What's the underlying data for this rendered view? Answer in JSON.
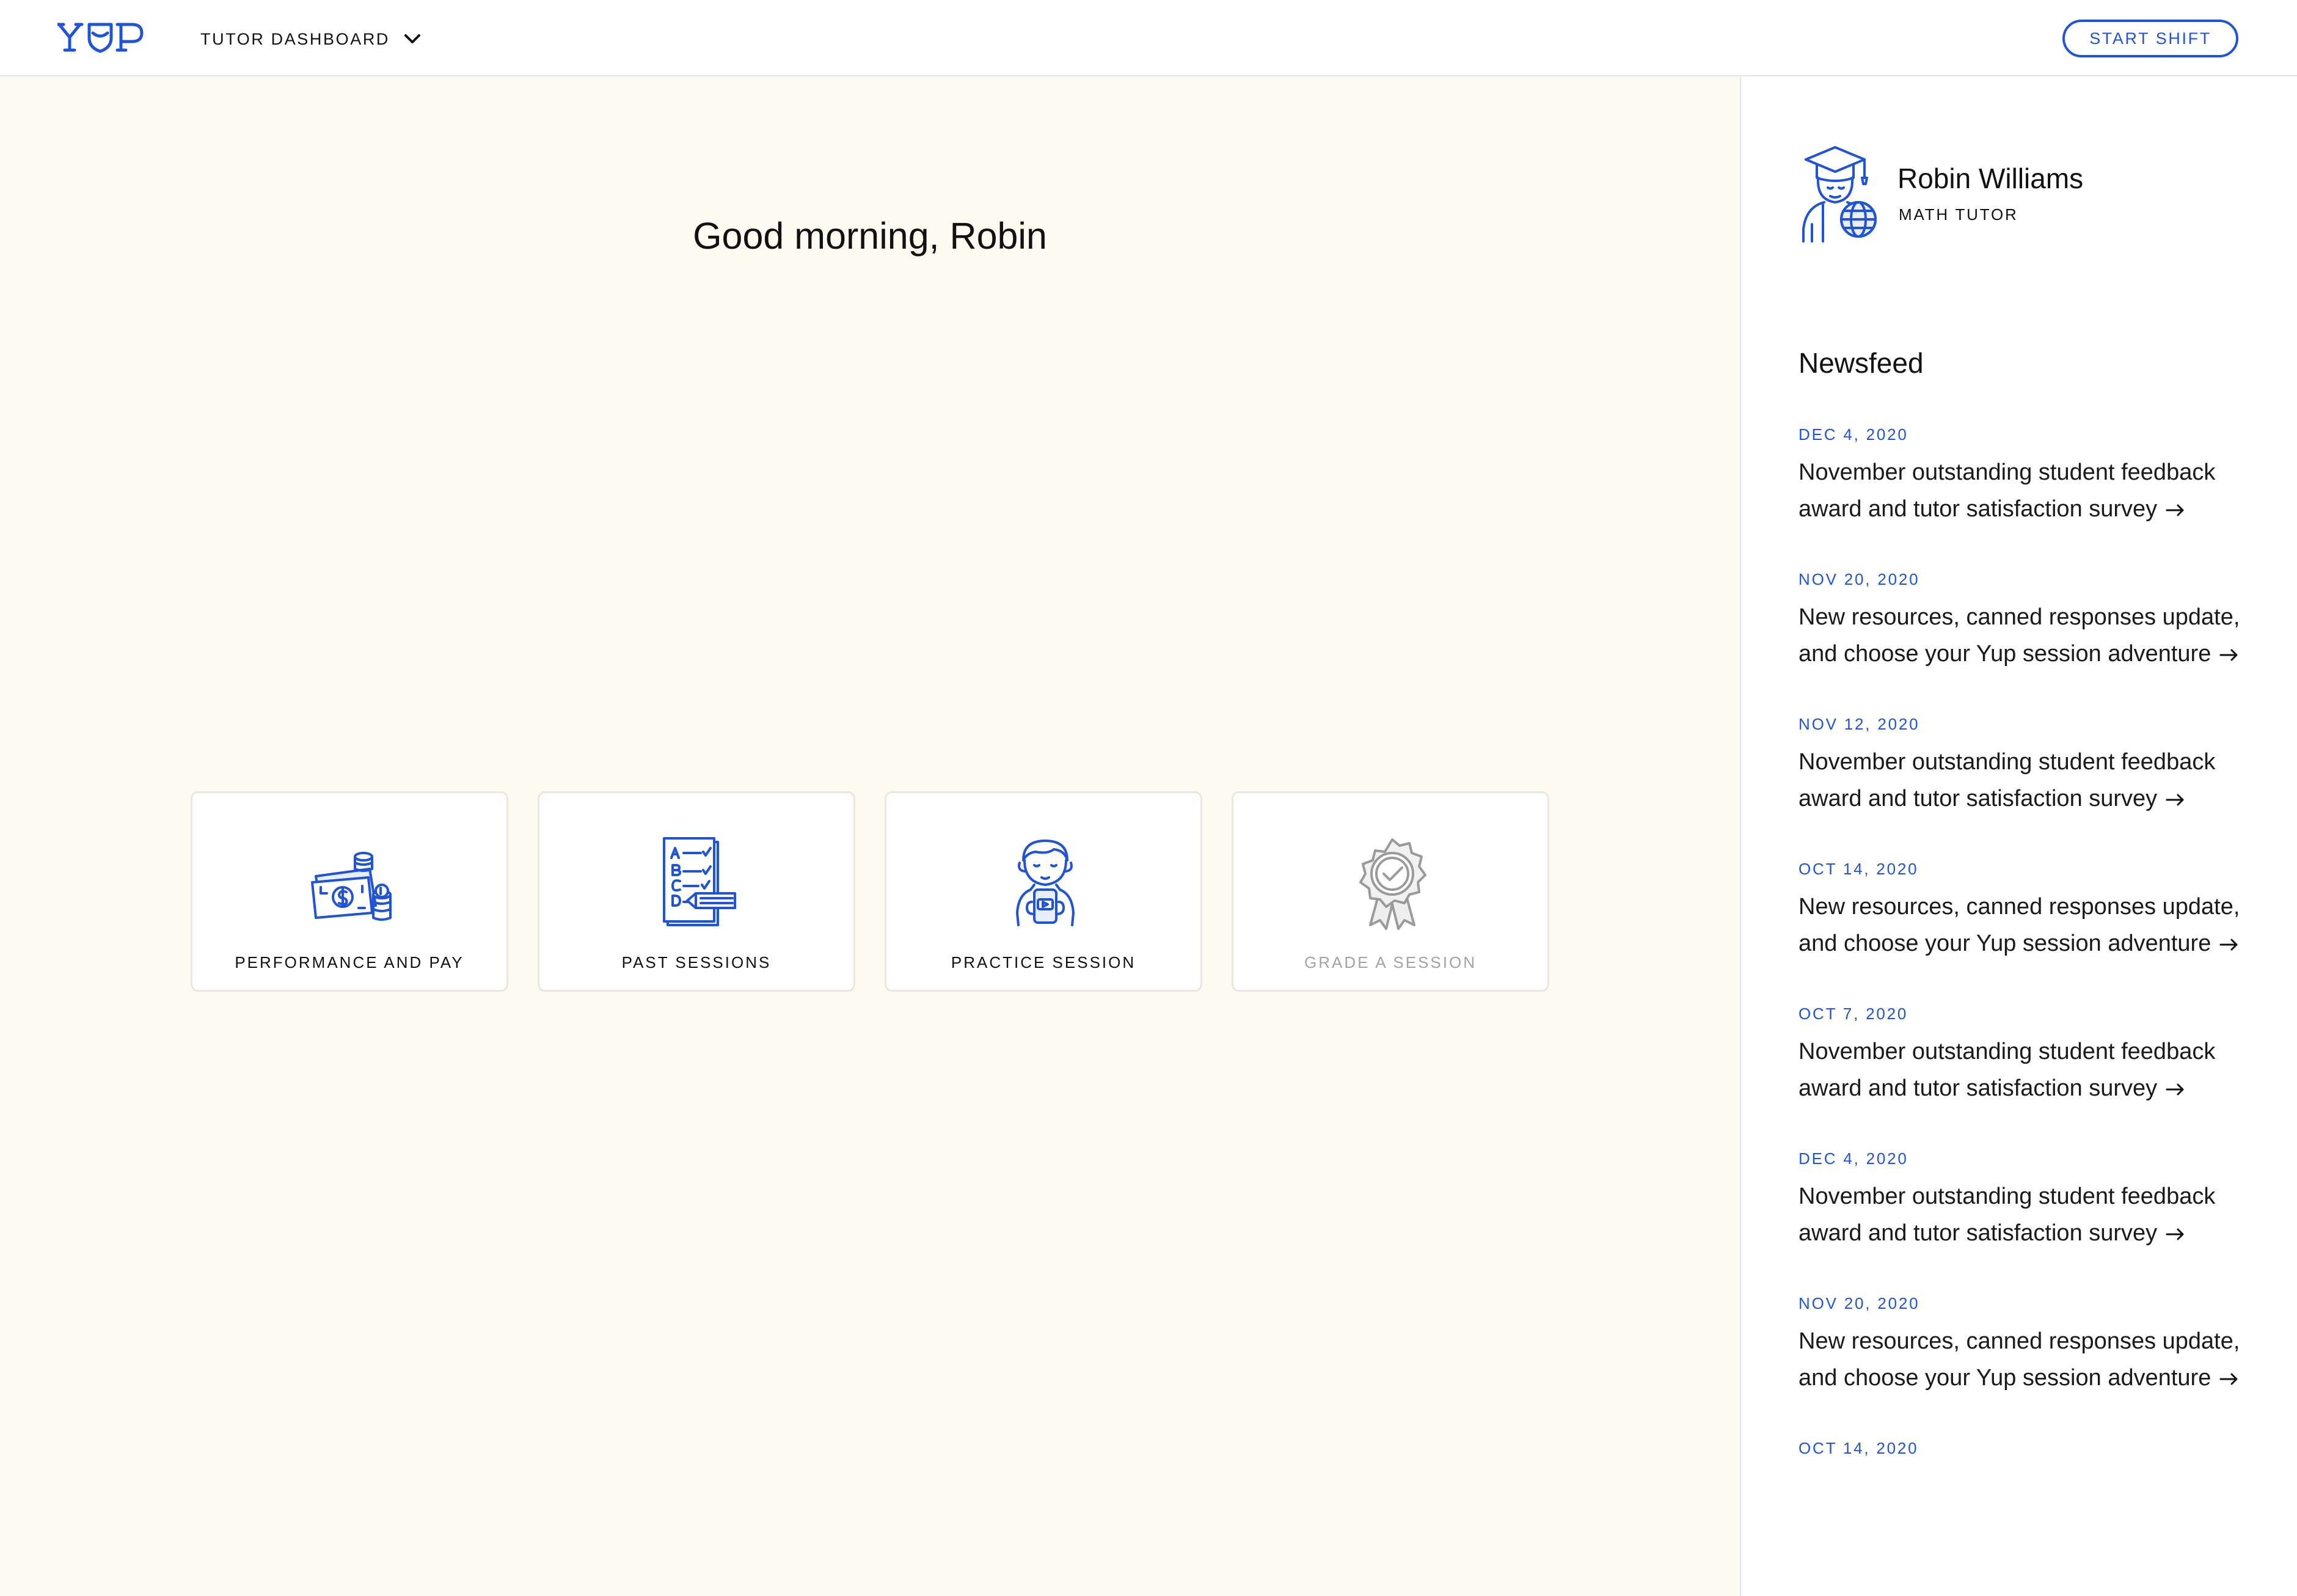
{
  "header": {
    "logo_text": "YUP",
    "nav_label": "TUTOR DASHBOARD",
    "start_shift_label": "START SHIFT"
  },
  "main": {
    "greeting": "Good morning, Robin",
    "cards": [
      {
        "label": "PERFORMANCE AND PAY",
        "icon": "money-coins-icon",
        "enabled": true
      },
      {
        "label": "PAST SESSIONS",
        "icon": "checklist-pencil-icon",
        "enabled": true
      },
      {
        "label": "PRACTICE SESSION",
        "icon": "student-phone-icon",
        "enabled": true
      },
      {
        "label": "GRADE A SESSION",
        "icon": "award-badge-icon",
        "enabled": false
      }
    ]
  },
  "profile": {
    "name": "Robin Williams",
    "role": "MATH TUTOR",
    "avatar_icon": "graduate-globe-icon"
  },
  "newsfeed": {
    "title": "Newsfeed",
    "items": [
      {
        "date": "DEC 4, 2020",
        "text": "November outstanding student feedback award and tutor satisfaction survey"
      },
      {
        "date": "NOV 20, 2020",
        "text": "New resources, canned responses update, and choose your Yup session adventure"
      },
      {
        "date": "NOV 12, 2020",
        "text": "November outstanding student feedback award and tutor satisfaction survey"
      },
      {
        "date": "OCT 14, 2020",
        "text": "New resources, canned responses update, and choose your Yup session adventure"
      },
      {
        "date": "OCT 7, 2020",
        "text": "November outstanding student feedback award and tutor satisfaction survey"
      },
      {
        "date": "DEC 4, 2020",
        "text": "November outstanding student feedback award and tutor satisfaction survey"
      },
      {
        "date": "NOV 20, 2020",
        "text": "New resources, canned responses update, and choose your Yup session adventure"
      },
      {
        "date": "OCT 14, 2020",
        "text": ""
      }
    ]
  },
  "colors": {
    "accent": "#1f54d6",
    "main_background": "#fdfaf2",
    "disabled_text": "#a3a3a3"
  }
}
